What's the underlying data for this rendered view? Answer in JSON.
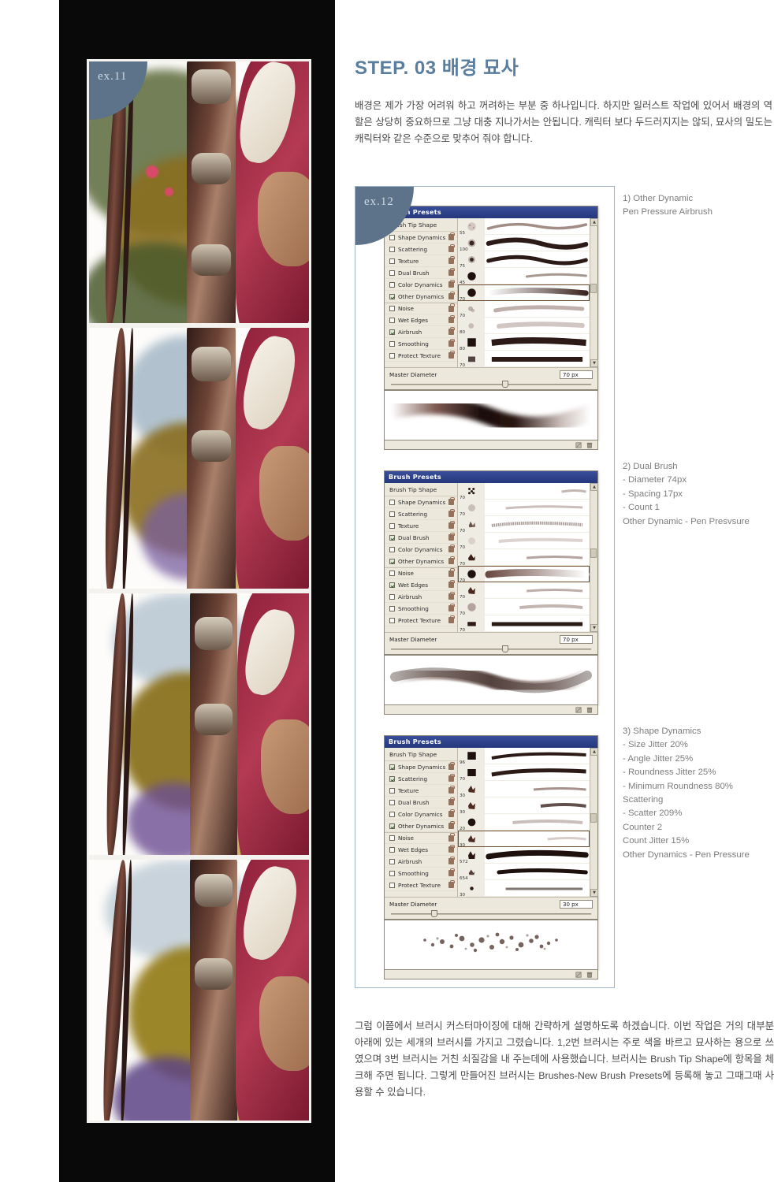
{
  "meta": {
    "illustration_label": "ex.11",
    "panel_label": "ex.12"
  },
  "header": {
    "title": "STEP. 03 배경 묘사"
  },
  "intro": {
    "paragraph": "배경은 제가 가장 어려워 하고 꺼려하는 부분 중 하나입니다. 하지만 일러스트 작업에 있어서 배경의 역할은 상당히 중요하므로 그냥 대충 지나가서는 안됩니다. 캐릭터 보다 두드러지지는 않되, 묘사의 밀도는 캐릭터와 같은 수준으로 맞추어 줘야 합니다."
  },
  "outro": {
    "paragraph": "그럼 이쯤에서 브러시 커스터마이징에 대해 간략하게 설명하도록 하겠습니다. 이번 작업은 거의 대부분 아래에 있는 세개의 브러시를 가지고 그렸습니다. 1,2번 브러시는 주로 색을 바르고 묘사하는 용으로 쓰였으며 3번 브러시는 거친 쇠질감을 내 주는데에 사용했습니다. 브러시는 Brush Tip Shape에 항목을 체크해 주면 됩니다. 그렇게 만들어진 브러시는 Brushes-New Brush Presets에 등록해 놓고 그때그때 사용할 수 있습니다."
  },
  "brush_panels": [
    {
      "title": "Brush Presets",
      "subheader": "Brush Tip Shape",
      "options": [
        {
          "label": "Shape Dynamics",
          "checked": false
        },
        {
          "label": "Scattering",
          "checked": false
        },
        {
          "label": "Texture",
          "checked": false
        },
        {
          "label": "Dual Brush",
          "checked": false
        },
        {
          "label": "Color Dynamics",
          "checked": false
        },
        {
          "label": "Other Dynamics",
          "checked": true
        },
        {
          "label": "Noise",
          "checked": false
        },
        {
          "label": "Wet Edges",
          "checked": false
        },
        {
          "label": "Airbrush",
          "checked": true
        },
        {
          "label": "Smoothing",
          "checked": false
        },
        {
          "label": "Protect Texture",
          "checked": false
        }
      ],
      "brush_sizes": [
        "55",
        "100",
        "75",
        "45",
        "70",
        "70",
        "80",
        "80",
        "70"
      ],
      "selected_brush_index": 5,
      "diameter_label": "Master Diameter",
      "diameter_value": "70 px",
      "slider_pct": 55
    },
    {
      "title": "Brush Presets",
      "subheader": "Brush Tip Shape",
      "options": [
        {
          "label": "Shape Dynamics",
          "checked": false
        },
        {
          "label": "Scattering",
          "checked": false
        },
        {
          "label": "Texture",
          "checked": false
        },
        {
          "label": "Dual Brush",
          "checked": true
        },
        {
          "label": "Color Dynamics",
          "checked": false
        },
        {
          "label": "Other Dynamics",
          "checked": true
        },
        {
          "label": "Noise",
          "checked": false
        },
        {
          "label": "Wet Edges",
          "checked": true
        },
        {
          "label": "Airbrush",
          "checked": false
        },
        {
          "label": "Smoothing",
          "checked": false
        },
        {
          "label": "Protect Texture",
          "checked": false
        }
      ],
      "brush_sizes": [
        "70",
        "70",
        "70",
        "70",
        "70",
        "70",
        "70",
        "70",
        "70"
      ],
      "selected_brush_index": 5,
      "diameter_label": "Master Diameter",
      "diameter_value": "70 px",
      "slider_pct": 55
    },
    {
      "title": "Brush Presets",
      "subheader": "Brush Tip Shape",
      "options": [
        {
          "label": "Shape Dynamics",
          "checked": true
        },
        {
          "label": "Scattering",
          "checked": true
        },
        {
          "label": "Texture",
          "checked": false
        },
        {
          "label": "Dual Brush",
          "checked": false
        },
        {
          "label": "Color Dynamics",
          "checked": false
        },
        {
          "label": "Other Dynamics",
          "checked": true
        },
        {
          "label": "Noise",
          "checked": false
        },
        {
          "label": "Wet Edges",
          "checked": false
        },
        {
          "label": "Airbrush",
          "checked": false
        },
        {
          "label": "Smoothing",
          "checked": false
        },
        {
          "label": "Protect Texture",
          "checked": false
        }
      ],
      "brush_sizes": [
        "96",
        "70",
        "30",
        "30",
        "20",
        "30",
        "572",
        "654",
        "30"
      ],
      "selected_brush_index": 5,
      "diameter_label": "Master Diameter",
      "diameter_value": "30 px",
      "slider_pct": 22
    }
  ],
  "notes": [
    {
      "lines": [
        "1) Other Dynamic",
        "Pen Pressure Airbrush"
      ]
    },
    {
      "lines": [
        "2) Dual Brush",
        "- Diameter 74px",
        "- Spacing 17px",
        "- Count 1",
        "Other Dynamic - Pen Presvsure"
      ]
    },
    {
      "lines": [
        "3) Shape Dynamics",
        "- Size Jitter  20%",
        "- Angle Jitter 25%",
        "- Roundness Jitter 25%",
        "- Minimum Roundness 80%",
        "Scattering",
        "- Scatter 209%",
        "Counter 2",
        "Count Jitter 15%",
        "Other Dynamics - Pen Pressure"
      ]
    }
  ],
  "colors": {
    "title_blue": "#5b7e9e",
    "body_gray": "#4a4a4a",
    "note_gray": "#7d7d7d",
    "box_border": "#9fb4c9",
    "ps_titlebar": "#24367c",
    "tab_blue": "#5c7389"
  }
}
